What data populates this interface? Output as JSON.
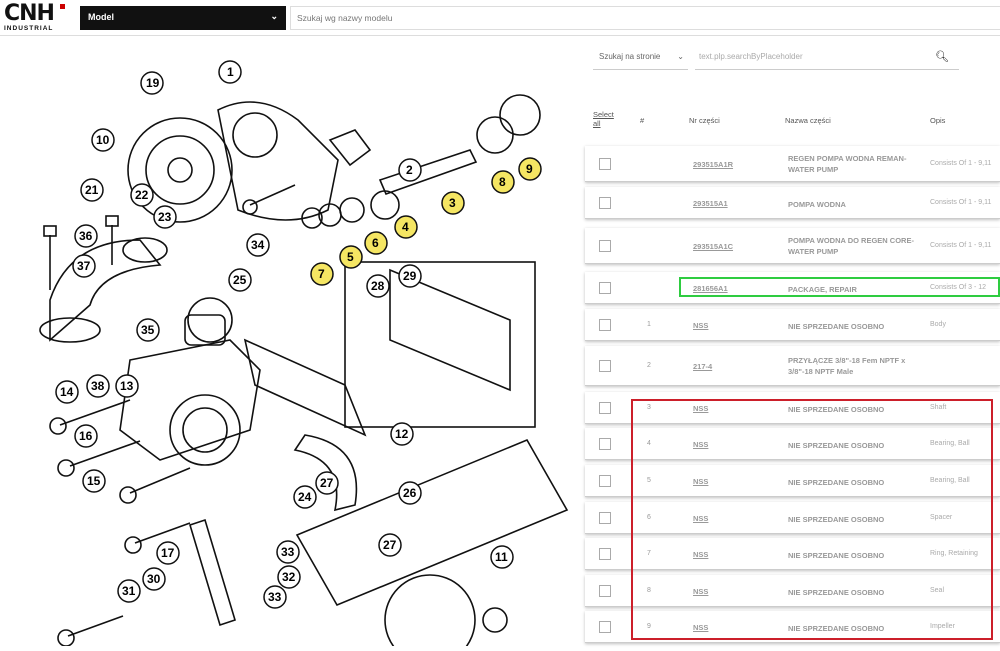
{
  "header": {
    "logo_text": "CNH",
    "logo_sub": "INDUSTRIAL",
    "model_label": "Model",
    "model_search_placeholder": "Szukaj wg nazwy modelu"
  },
  "toolbar": {
    "search_scope": "Szukaj na stronie",
    "search_placeholder": "text.plp.searchByPlaceholder"
  },
  "table": {
    "headers": {
      "select_all": "Select all",
      "index": "#",
      "part_no": "Nr części",
      "part_name": "Nazwa części",
      "desc": "Opis"
    },
    "rows": [
      {
        "num": "",
        "part": "293515A1R",
        "name": "REGEN POMPA WODNA REMAN-WATER PUMP",
        "desc": "Consists Of 1 - 9,11"
      },
      {
        "num": "",
        "part": "293515A1",
        "name": "POMPA WODNA",
        "desc": "Consists Of 1 - 9,11"
      },
      {
        "num": "",
        "part": "293515A1C",
        "name": "POMPA WODNA DO REGEN CORE-WATER PUMP",
        "desc": "Consists Of 1 - 9,11"
      },
      {
        "num": "",
        "part": "281656A1",
        "name": "PACKAGE, REPAIR",
        "desc": "Consists Of 3 - 12"
      },
      {
        "num": "1",
        "part": "NSS",
        "name": "NIE SPRZEDANE OSOBNO",
        "desc": "Body"
      },
      {
        "num": "2",
        "part": "217-4",
        "name": "PRZYŁĄCZE 3/8\"-18 Fem NPTF x 3/8\"-18 NPTF Male",
        "desc": ""
      },
      {
        "num": "3",
        "part": "NSS",
        "name": "NIE SPRZEDANE OSOBNO",
        "desc": "Shaft"
      },
      {
        "num": "4",
        "part": "NSS",
        "name": "NIE SPRZEDANE OSOBNO",
        "desc": "Bearing, Ball"
      },
      {
        "num": "5",
        "part": "NSS",
        "name": "NIE SPRZEDANE OSOBNO",
        "desc": "Bearing, Ball"
      },
      {
        "num": "6",
        "part": "NSS",
        "name": "NIE SPRZEDANE OSOBNO",
        "desc": "Spacer"
      },
      {
        "num": "7",
        "part": "NSS",
        "name": "NIE SPRZEDANE OSOBNO",
        "desc": "Ring, Retaining"
      },
      {
        "num": "8",
        "part": "NSS",
        "name": "NIE SPRZEDANE OSOBNO",
        "desc": "Seal"
      },
      {
        "num": "9",
        "part": "NSS",
        "name": "NIE SPRZEDANE OSOBNO",
        "desc": "Impeller"
      }
    ]
  },
  "diagram": {
    "callouts": [
      "1",
      "2",
      "3",
      "4",
      "5",
      "6",
      "7",
      "8",
      "9",
      "10",
      "11",
      "12",
      "13",
      "14",
      "15",
      "16",
      "17",
      "19",
      "21",
      "22",
      "23",
      "24",
      "25",
      "26",
      "27",
      "27",
      "28",
      "29",
      "30",
      "31",
      "32",
      "33",
      "33",
      "34",
      "35",
      "36",
      "37",
      "38"
    ],
    "highlighted_callouts": [
      "3",
      "4",
      "5",
      "6",
      "7",
      "8",
      "9"
    ],
    "highlight_color": "#f5e663"
  },
  "colors": {
    "green_box": "#2ecc40",
    "red_box": "#cc1f2a"
  }
}
